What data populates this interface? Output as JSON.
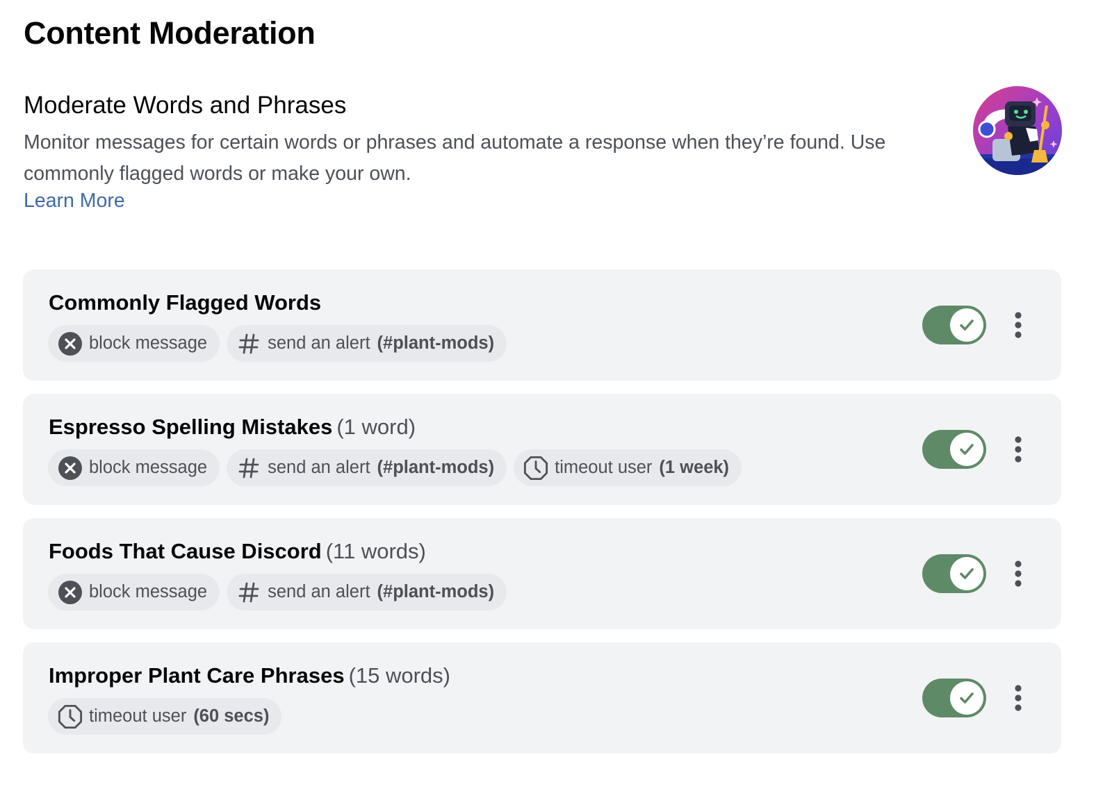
{
  "header": {
    "title": "Content Moderation"
  },
  "section": {
    "title": "Moderate Words and Phrases",
    "description": "Monitor messages for certain words or phrases and automate a response when they’re found. Use commonly flagged words or make your own.",
    "learn_more": "Learn More",
    "illustration_icon": "automod-robot-illustration"
  },
  "colors": {
    "toggle_on": "#5f8a67",
    "link": "#3f6aa8",
    "card_bg": "#f2f3f5",
    "chip_bg": "#e8e9ec"
  },
  "rules": [
    {
      "name": "Commonly Flagged Words",
      "count": "",
      "enabled": true,
      "actions": [
        {
          "icon": "x-circle-icon",
          "label": "block message",
          "detail": ""
        },
        {
          "icon": "hashtag-icon",
          "label": "send an alert",
          "detail": "(#plant-mods)"
        }
      ]
    },
    {
      "name": "Espresso Spelling Mistakes",
      "count": "(1 word)",
      "enabled": true,
      "actions": [
        {
          "icon": "x-circle-icon",
          "label": "block message",
          "detail": ""
        },
        {
          "icon": "hashtag-icon",
          "label": "send an alert",
          "detail": "(#plant-mods)"
        },
        {
          "icon": "clock-icon",
          "label": "timeout user",
          "detail": "(1 week)"
        }
      ]
    },
    {
      "name": "Foods That Cause Discord",
      "count": "(11 words)",
      "enabled": true,
      "actions": [
        {
          "icon": "x-circle-icon",
          "label": "block message",
          "detail": ""
        },
        {
          "icon": "hashtag-icon",
          "label": "send an alert",
          "detail": "(#plant-mods)"
        }
      ]
    },
    {
      "name": "Improper Plant Care Phrases",
      "count": "(15 words)",
      "enabled": true,
      "actions": [
        {
          "icon": "clock-icon",
          "label": "timeout user",
          "detail": "(60 secs)"
        }
      ]
    }
  ]
}
